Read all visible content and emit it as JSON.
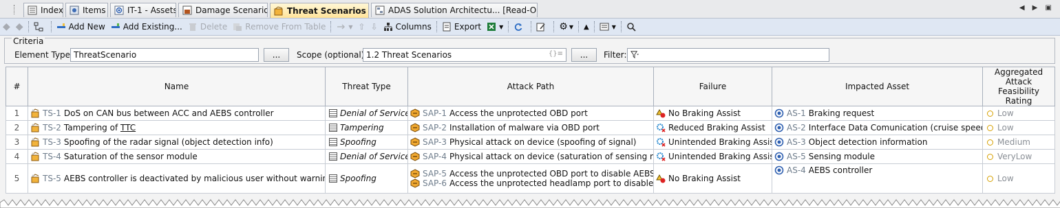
{
  "tabs": [
    {
      "label": "Index",
      "icon": "index-icon",
      "active": false
    },
    {
      "label": "Items",
      "icon": "items-icon",
      "active": false
    },
    {
      "label": "IT-1 - Assets",
      "icon": "assets-icon",
      "active": false
    },
    {
      "label": "Damage Scenarios",
      "icon": "damage-icon",
      "active": false
    },
    {
      "label": "Threat Scenarios",
      "icon": "threat-icon",
      "active": true
    },
    {
      "label": "ADAS Solution Architectu... [Read-Only]",
      "icon": "diagram-icon",
      "active": false
    }
  ],
  "tab_close": "✕",
  "tab_nav": "◀ ▶ ▣",
  "toolbar": {
    "add_new": "Add New",
    "add_existing": "Add Existing...",
    "delete": "Delete",
    "remove_from_table": "Remove From Table",
    "columns": "Columns",
    "export": "Export"
  },
  "criteria": {
    "legend": "Criteria",
    "element_type_label": "Element Type:",
    "element_type_value": "ThreatScenario",
    "dots": "...",
    "scope_label": "Scope (optional):",
    "scope_value": "1.2 Threat Scenarios",
    "scope_hint": "{}≡",
    "filter_label": "Filter:"
  },
  "table": {
    "columns": [
      "#",
      "Name",
      "Threat Type",
      "Attack Path",
      "Failure",
      "Impacted Asset",
      "Aggregated Attack Feasibility Rating"
    ],
    "rows": [
      {
        "num": "1",
        "id": "TS-1",
        "name": "DoS on CAN bus between ACC and AEBS controller",
        "name_u": "",
        "threat_type": "Denial of Service",
        "paths": [
          {
            "id": "SAP-1",
            "text": "Access the unprotected OBD port"
          }
        ],
        "failure": "No Braking Assist",
        "failure_icon": "warning-icon",
        "asset_id": "AS-1",
        "asset": "Braking request",
        "asset_u": "",
        "rating": "Low"
      },
      {
        "num": "2",
        "id": "TS-2",
        "name": "Tampering of ",
        "name_u": "TTC",
        "threat_type": "Tampering",
        "paths": [
          {
            "id": "SAP-2",
            "text": "Installation of malware via OBD port"
          }
        ],
        "failure": "Reduced Braking Assist",
        "failure_icon": "gear-error-icon",
        "asset_id": "AS-2",
        "asset": "Interface Data Comunication (cruise speed, ",
        "asset_u": "TTC",
        "asset_tail": ")",
        "rating": "Low"
      },
      {
        "num": "3",
        "id": "TS-3",
        "name": "Spoofing of the radar signal (object detection info)",
        "name_u": "",
        "threat_type": "Spoofing",
        "paths": [
          {
            "id": "SAP-3",
            "text": "Physical attack on device (spoofing of signal)"
          }
        ],
        "failure": "Unintended Braking Assist",
        "failure_icon": "gear-error-icon",
        "asset_id": "AS-3",
        "asset": "Object detection information",
        "asset_u": "",
        "rating": "Medium"
      },
      {
        "num": "4",
        "id": "TS-4",
        "name": "Saturation of the sensor module",
        "name_u": "",
        "threat_type": "Denial of Service",
        "paths": [
          {
            "id": "SAP-4",
            "text": "Physical attack on device (saturation of sensing module)"
          }
        ],
        "failure": "Unintended Braking Assist",
        "failure_icon": "gear-error-icon",
        "asset_id": "AS-5",
        "asset": "Sensing module",
        "asset_u": "",
        "rating": "VeryLow"
      },
      {
        "num": "5",
        "id": "TS-5",
        "name": "AEBS controller is deactivated by malicious user without warnings",
        "name_u": "",
        "threat_type": "Spoofing",
        "paths": [
          {
            "id": "SAP-5",
            "text": "Access the unprotected OBD port to disable AEBS"
          },
          {
            "id": "SAP-6",
            "text": "Access the unprotected headlamp port to disable AEBS"
          }
        ],
        "failure": "No Braking Assist",
        "failure_icon": "warning-icon",
        "asset_id": "AS-4",
        "asset": "AEBS controller",
        "asset_u": "",
        "rating": "Low"
      }
    ]
  },
  "colors": {
    "accent": "#ffe49a",
    "toolbar": "#dfe7f3",
    "rating_ring": "#d6a000",
    "threat_icon": "#e8a21a"
  }
}
